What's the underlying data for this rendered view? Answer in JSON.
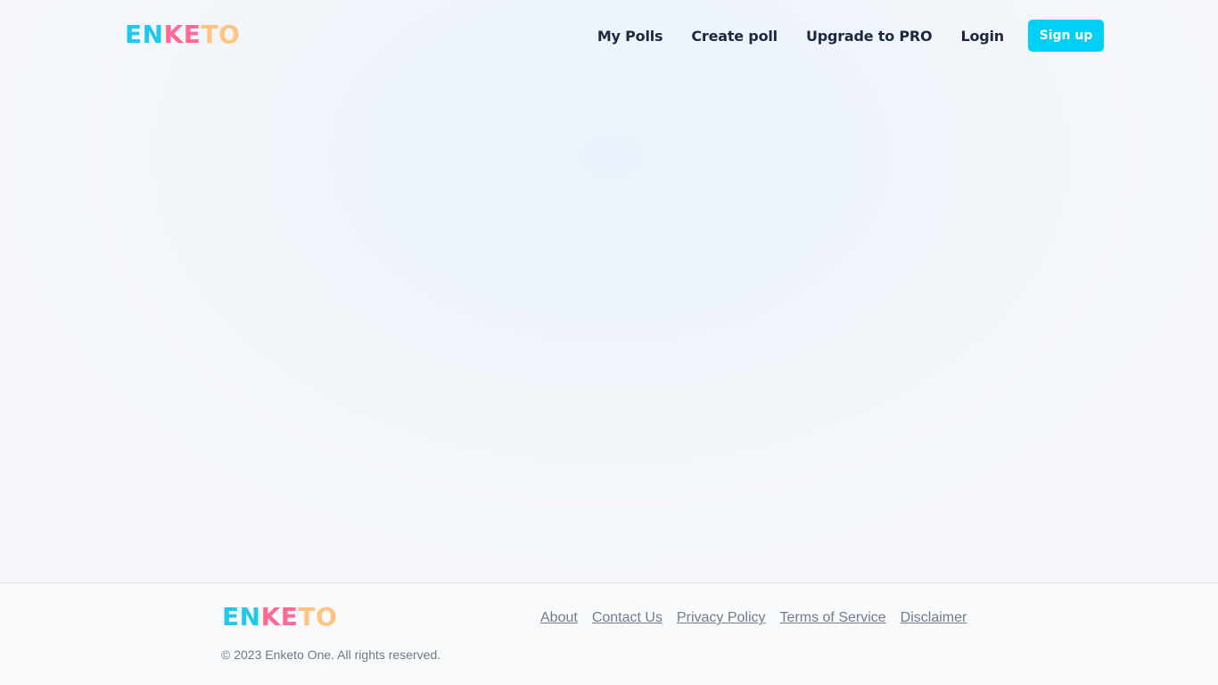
{
  "header": {
    "logo": {
      "part1": "EN",
      "part2": "KE",
      "part3": "TO"
    },
    "nav": {
      "my_polls": "My Polls",
      "create_poll": "Create poll",
      "upgrade": "Upgrade to PRO",
      "login": "Login",
      "signup": "Sign up"
    }
  },
  "footer": {
    "logo": {
      "part1": "EN",
      "part2": "KE",
      "part3": "TO"
    },
    "copyright": "© 2023 Enketo One. All rights reserved.",
    "links": {
      "about": "About",
      "contact": "Contact Us",
      "privacy": "Privacy Policy",
      "terms": "Terms of Service",
      "disclaimer": "Disclaimer"
    }
  },
  "colors": {
    "brand_cyan": "#1ec8ee",
    "brand_pink": "#ff6a95",
    "brand_peach": "#ffc47e",
    "signup_button": "#00d0f5",
    "nav_text": "#1f2740"
  }
}
